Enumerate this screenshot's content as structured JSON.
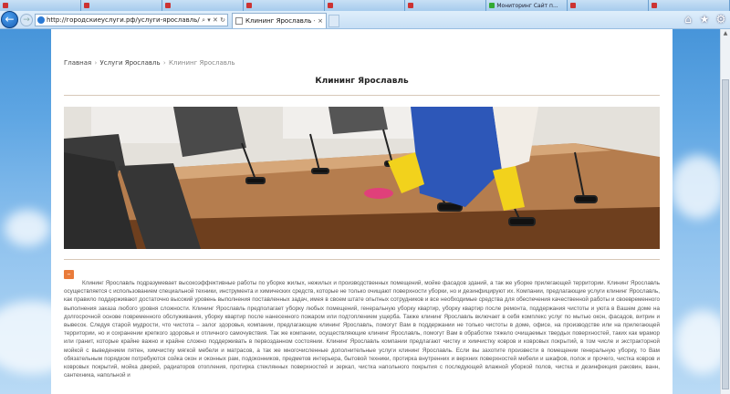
{
  "browser": {
    "tabs": [
      {
        "label": ""
      },
      {
        "label": ""
      },
      {
        "label": ""
      },
      {
        "label": ""
      },
      {
        "label": ""
      },
      {
        "label": ""
      },
      {
        "label": "Мониторинг Сайт п..."
      },
      {
        "label": ""
      },
      {
        "label": ""
      }
    ],
    "address": "http://городскиеуслуги.рф/услуги-ярославль/клининг-",
    "address_controls": "⌕ ▾ ✕ ↻",
    "active_tab_title": "Клининг Ярославль - на п...",
    "active_tab_close": "×",
    "back_glyph": "←",
    "forward_glyph": "→",
    "tool_icons": [
      {
        "name": "home-icon",
        "glyph": "⌂"
      },
      {
        "name": "favorites-star-icon",
        "glyph": "★"
      },
      {
        "name": "settings-gear-icon",
        "glyph": "⚙"
      }
    ]
  },
  "page": {
    "breadcrumb": {
      "home": "Главная",
      "sep1": "›",
      "services": "Услуги Ярославль",
      "sep2": "›",
      "current": "Клининг Ярославль"
    },
    "title": "Клининг Ярославль",
    "hero_image": "office-cleaning-photo",
    "toggle_symbol": "–",
    "body_text": "Клининг Ярославль подразумевает высокоэффективные работы по уборке жилых, нежилых и производственных помещений, мойке фасадов зданий, а так же уборке прилегающей территории. Клининг Ярославль осуществляется с использованием специальной техники, инструмента и химических средств, которые не только очищают поверхности уборки, но и дезинфицируют их. Компании, предлагающие услуги клининг Ярославль, как правило поддерживают достаточно высокий уровень выполнения поставленных задач, имея в своем штате опытных сотрудников и все необходимые средства для обеспечения качественной работы и своевременного выполнения заказа любого уровня сложности. Клининг Ярославль предполагает уборку любых помещений, генеральную уборку квартир, уборку квартир после ремонта, поддержания чистоты и уюта в Вашем доме на долгосрочной основе повременного обслуживания, уборку квартир после нанесенного пожаром или подтоплением ущерба. Также клининг Ярославль включает в себя комплекс услуг по мытью окон, фасадов, витрин и вывесок. Следуя старой мудрости, что чистота – залог здоровья, компании, предлагающие клининг Ярославль, помогут Вам в поддержании не только чистоты в доме, офисе, на производстве или на прилегающей территории, но и сохранении крепкого здоровья и отличного самочувствия. Так же компании, осуществляющие клининг Ярославль, помогут Вам в обработке тяжело очищаемых твердых поверхностей, таких как мрамор или гранит, которые крайне важно и крайне сложно поддерживать в первозданном состоянии. Клининг Ярославль компании предлагают чистку и химчистку ковров и ковровых покрытий, в том числе и экстракторной мойкой с выведением пятен, химчистку мягкой мебели и матрасов, а так же многочисленные дополнительные услуги клининг Ярославль. Если вы захотите произвести в помещении генеральную уборку, то Вам обязательным порядком потребуются сойка окон и оконных рам, подоконников, предметов интерьера, бытовой техники, протирка внутренних и верхних поверхностей мебели и шкафов, полок и прочего, чистка ковров и ковровых покрытий, мойка дверей, радиаторов отопления, протирка стеклянных поверхностей и зеркал, чистка напольного покрытия с последующей влажной уборкой полов, чистка и дезинфекция раковин, ванн, сантехника, напольной и"
  },
  "colors": {
    "accent_orange": "#e97b3a",
    "divider": "#d8c8b8",
    "sky": "#5fa6e3"
  }
}
